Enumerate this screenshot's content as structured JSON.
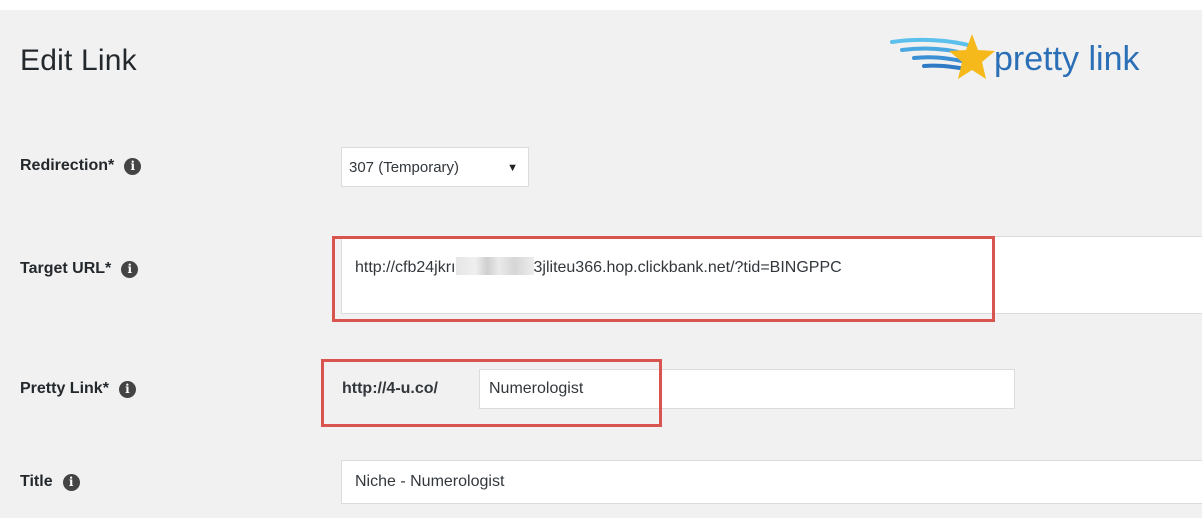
{
  "header": {
    "title": "Edit Link",
    "logo_text": "pretty link"
  },
  "fields": {
    "redirection": {
      "label": "Redirection*",
      "value": "307 (Temporary)"
    },
    "target_url": {
      "label": "Target URL*",
      "value_start": "http://cfb24jkrı",
      "value_end": "3jliteu366.hop.clickbank.net/?tid=BINGPPC"
    },
    "pretty_link": {
      "label": "Pretty Link*",
      "prefix": "http://4-u.co/",
      "value": "Numerologist"
    },
    "title": {
      "label": "Title",
      "value": "Niche - Numerologist"
    }
  },
  "icons": {
    "info": "info-icon",
    "dropdown": "chevron-down-icon",
    "logo": "star-logo-icon"
  },
  "colors": {
    "highlight": "#d9534f",
    "logo_blue": "#2b6fb6",
    "star": "#f5b91c"
  }
}
